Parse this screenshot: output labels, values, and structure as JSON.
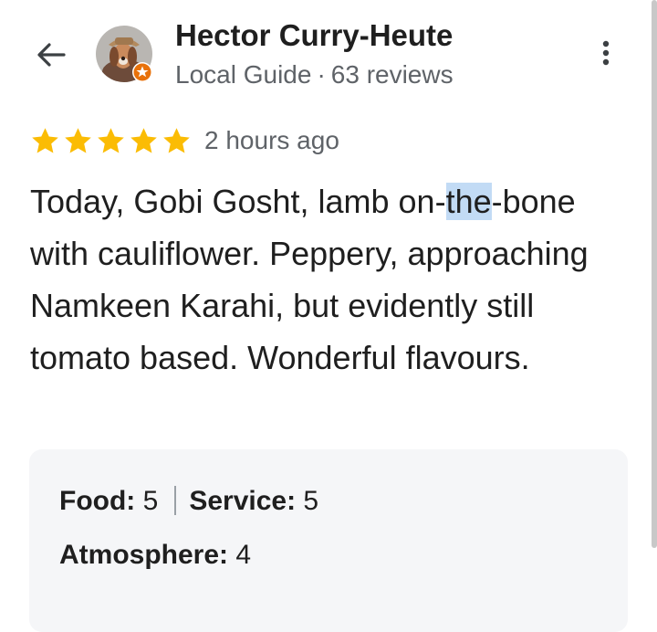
{
  "header": {
    "back_icon": "arrow-back-icon",
    "reviewer_name": "Hector Curry-Heute",
    "reviewer_level": "Local Guide",
    "separator": "·",
    "review_count": "63 reviews",
    "menu_icon": "more-vert-icon"
  },
  "review": {
    "stars": 5,
    "star_color": "#fbbc04",
    "time": "2 hours ago",
    "text_before": "Today, Gobi Gosht, lamb on-",
    "text_highlight": "the",
    "text_after": "-bone with cauliflower. Peppery, approaching Namkeen Karahi, but evidently still tomato based. Wonderful flavours.",
    "highlight_color": "#c2dbf5"
  },
  "ratings": {
    "food_label": "Food:",
    "food_value": "5",
    "service_label": "Service:",
    "service_value": "5",
    "atmosphere_label": "Atmosphere:",
    "atmosphere_value": "4"
  }
}
